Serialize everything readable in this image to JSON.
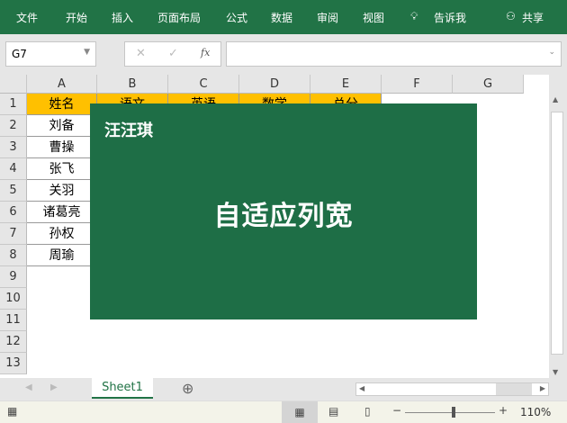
{
  "ribbon": {
    "tabs": [
      "文件",
      "开始",
      "插入",
      "页面布局",
      "公式",
      "数据",
      "审阅",
      "视图"
    ],
    "tell_me": "告诉我",
    "share": "共享"
  },
  "formula_bar": {
    "name_box": "G7",
    "cancel": "✕",
    "enter": "✓",
    "fx": "fx",
    "formula": ""
  },
  "columns": [
    "A",
    "B",
    "C",
    "D",
    "E",
    "F",
    "G"
  ],
  "rows": [
    "1",
    "2",
    "3",
    "4",
    "5",
    "6",
    "7",
    "8",
    "9",
    "10",
    "11",
    "12",
    "13"
  ],
  "headers": [
    "姓名",
    "语文",
    "英语",
    "数学",
    "总分"
  ],
  "names": [
    "刘备",
    "曹操",
    "张飞",
    "关羽",
    "诸葛亮",
    "孙权",
    "周瑜"
  ],
  "overlay": {
    "brand": "汪汪琪",
    "title": "自适应列宽",
    "color": "#1e6e46"
  },
  "sheets": {
    "active": "Sheet1"
  },
  "status": {
    "zoom": "110%",
    "zoom_level": 110
  },
  "colors": {
    "accent": "#217346",
    "header_fill": "#ffc000"
  }
}
